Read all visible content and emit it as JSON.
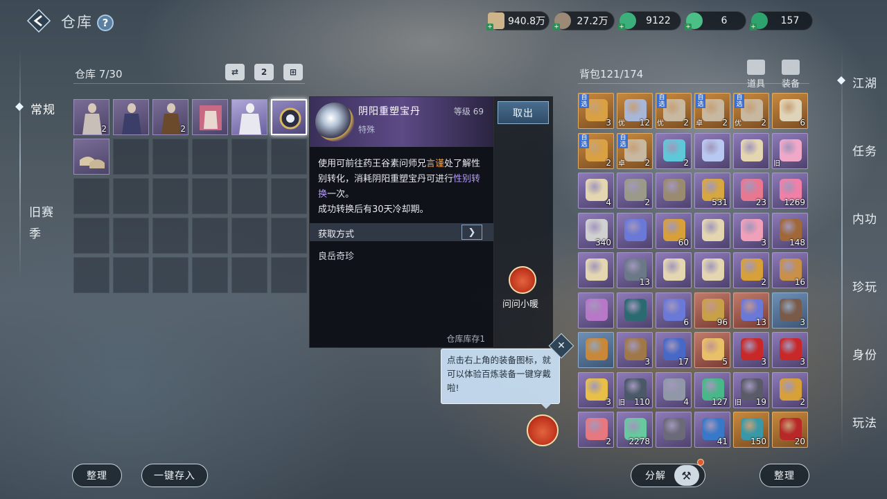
{
  "header": {
    "title": "仓库",
    "help": "?"
  },
  "currencies": [
    {
      "icon": "silver-ticket-icon",
      "value": "940.8万",
      "color": "#cdb48a"
    },
    {
      "icon": "copper-coin-icon",
      "value": "27.2万",
      "color": "#9a8a76"
    },
    {
      "icon": "jade-coin-icon",
      "value": "9122",
      "color": "#3bb07a"
    },
    {
      "icon": "jade-token-icon",
      "value": "6",
      "color": "#4bbf86"
    },
    {
      "icon": "jade-orb-icon",
      "value": "157",
      "color": "#2fa36e"
    }
  ],
  "left_nav": {
    "items": [
      "常规",
      "旧赛",
      "季"
    ]
  },
  "warehouse": {
    "label": "仓库",
    "capacity": "7/30",
    "header_icons": [
      "transfer-icon",
      "page-2-icon",
      "grid-icon"
    ],
    "header_icon_text": "2",
    "items": [
      {
        "count": "2"
      },
      {
        "count": ""
      },
      {
        "count": "2"
      },
      {
        "count": ""
      },
      {
        "count": ""
      },
      {
        "count": ""
      },
      {
        "count": ""
      }
    ]
  },
  "tooltip": {
    "name": "阴阳重塑宝丹",
    "type": "特殊",
    "level_label": "等级 69",
    "desc_1": "使用可前往药王谷素问师兄",
    "desc_hl_1": "言谨",
    "desc_2": "处了解性别转化，消耗阴阳重塑宝丹可进行",
    "desc_hl_2": "性别转换",
    "desc_3": "一次。",
    "desc_4": "成功转换后有30天冷却期。",
    "source_label": "获取方式",
    "source_value": "良岳奇珍",
    "stock": "仓库库存1",
    "take_button": "取出",
    "ask_label": "问问小暖"
  },
  "bubble": {
    "text": "点击右上角的装备图标，就可以体验百炼装备一键穿戴啦!",
    "close": "✕"
  },
  "backpack": {
    "label": "背包",
    "capacity": "121/174",
    "tabs": [
      "道具",
      "装备"
    ],
    "items": [
      {
        "q": "gold",
        "tag": "自选",
        "count": "3",
        "c": "#d9a044"
      },
      {
        "q": "gold",
        "tag": "",
        "bot": "优",
        "count": "12",
        "c": "#a8b6d8"
      },
      {
        "q": "gold",
        "tag": "自选",
        "bot": "优",
        "count": "2",
        "c": "#c8b8a0"
      },
      {
        "q": "gold",
        "tag": "自选",
        "bot": "卓",
        "count": "2",
        "c": "#c8b8a0"
      },
      {
        "q": "gold",
        "tag": "自选",
        "bot": "优",
        "count": "2",
        "c": "#c8b8a0"
      },
      {
        "q": "gold",
        "tag": "",
        "count": "6",
        "c": "#e0d4b8"
      },
      {
        "q": "gold",
        "tag": "自选",
        "count": "2",
        "c": "#d9a044"
      },
      {
        "q": "gold",
        "tag": "自选",
        "bot": "卓",
        "count": "2",
        "c": "#c8b8a0"
      },
      {
        "q": "purple",
        "tag": "",
        "count": "2",
        "c": "#5fc8d8"
      },
      {
        "q": "purple",
        "tag": "",
        "count": "",
        "c": "#b8c8f0"
      },
      {
        "q": "purple",
        "tag": "",
        "count": "",
        "c": "#e4d6b0"
      },
      {
        "q": "purple",
        "tag": "",
        "bot": "旧",
        "count": "",
        "c": "#f0a8c8"
      },
      {
        "q": "purple",
        "tag": "",
        "count": "4",
        "c": "#e4d6b0"
      },
      {
        "q": "purple",
        "tag": "",
        "count": "2",
        "c": "#9a9a88"
      },
      {
        "q": "purple",
        "tag": "",
        "count": "",
        "c": "#9a8a70"
      },
      {
        "q": "purple",
        "tag": "",
        "count": "531",
        "c": "#d8a840"
      },
      {
        "q": "purple",
        "tag": "",
        "count": "23",
        "c": "#e87890"
      },
      {
        "q": "purple",
        "tag": "",
        "count": "1269",
        "c": "#f080a8"
      },
      {
        "q": "purple",
        "tag": "",
        "count": "340",
        "c": "#d0d0d0"
      },
      {
        "q": "purple",
        "tag": "",
        "count": "",
        "c": "#6a78d8"
      },
      {
        "q": "purple",
        "tag": "",
        "count": "60",
        "c": "#d8a038"
      },
      {
        "q": "purple",
        "tag": "",
        "count": "",
        "c": "#e4d6b0"
      },
      {
        "q": "purple",
        "tag": "",
        "count": "3",
        "c": "#f0a0b8"
      },
      {
        "q": "purple",
        "tag": "",
        "count": "148",
        "c": "#a06838"
      },
      {
        "q": "purple",
        "tag": "",
        "count": "",
        "c": "#e4d6b0"
      },
      {
        "q": "purple",
        "tag": "",
        "count": "13",
        "c": "#6a7888"
      },
      {
        "q": "purple",
        "tag": "",
        "count": "",
        "c": "#e4d6b0"
      },
      {
        "q": "purple",
        "tag": "",
        "count": "",
        "c": "#e4d6b0"
      },
      {
        "q": "purple",
        "tag": "",
        "count": "2",
        "c": "#d8a038"
      },
      {
        "q": "purple",
        "tag": "",
        "count": "16",
        "c": "#c89048"
      },
      {
        "q": "purple",
        "tag": "",
        "count": "",
        "c": "#b878c8"
      },
      {
        "q": "purple",
        "tag": "",
        "count": "",
        "c": "#2a6a70"
      },
      {
        "q": "purple",
        "tag": "",
        "count": "6",
        "c": "#6a78d8"
      },
      {
        "q": "red",
        "tag": "",
        "count": "96",
        "c": "#c8a048"
      },
      {
        "q": "red",
        "tag": "",
        "count": "13",
        "c": "#6a78d8"
      },
      {
        "q": "blue",
        "tag": "",
        "count": "3",
        "c": "#7a5a48"
      },
      {
        "q": "blue",
        "tag": "",
        "count": "",
        "c": "#c88838"
      },
      {
        "q": "purple",
        "tag": "",
        "count": "3",
        "c": "#a07848"
      },
      {
        "q": "purple",
        "tag": "",
        "count": "17",
        "c": "#4868c8"
      },
      {
        "q": "red",
        "tag": "",
        "count": "5",
        "c": "#e8c068"
      },
      {
        "q": "purple",
        "tag": "",
        "count": "3",
        "c": "#c82828"
      },
      {
        "q": "purple",
        "tag": "",
        "count": "3",
        "c": "#c82828"
      },
      {
        "q": "purple",
        "tag": "",
        "count": "3",
        "c": "#e8c048"
      },
      {
        "q": "purple",
        "tag": "",
        "bot": "旧",
        "count": "110",
        "c": "#4a5868"
      },
      {
        "q": "purple",
        "tag": "",
        "count": "4",
        "c": "#9098a8"
      },
      {
        "q": "purple",
        "tag": "",
        "count": "127",
        "c": "#48b888"
      },
      {
        "q": "purple",
        "tag": "",
        "bot": "旧",
        "count": "19",
        "c": "#5a5a68"
      },
      {
        "q": "purple",
        "tag": "",
        "count": "2",
        "c": "#d8a038"
      },
      {
        "q": "purple",
        "tag": "",
        "count": "2",
        "c": "#e87880"
      },
      {
        "q": "purple",
        "tag": "",
        "count": "2278",
        "c": "#68c8a0"
      },
      {
        "q": "purple",
        "tag": "",
        "count": "",
        "c": "#6a6a78"
      },
      {
        "q": "purple",
        "tag": "",
        "count": "41",
        "c": "#3878c8"
      },
      {
        "q": "gold",
        "tag": "",
        "count": "150",
        "c": "#3898a8"
      },
      {
        "q": "gold",
        "tag": "",
        "count": "20",
        "c": "#b82828"
      }
    ]
  },
  "right_nav": {
    "items": [
      "江湖",
      "任务",
      "内功",
      "珍玩",
      "身份",
      "玩法"
    ]
  },
  "bottom": {
    "sort_left": "整理",
    "deposit_all": "一键存入",
    "decompose": "分解",
    "sort_right": "整理"
  }
}
